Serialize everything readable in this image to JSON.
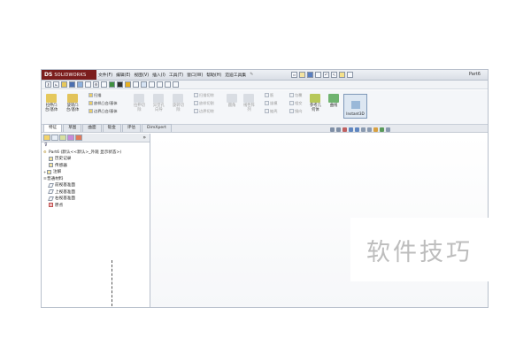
{
  "app": {
    "logo_mark": "DS",
    "logo_name": "SOLIDWORKS",
    "document_title": "Part6"
  },
  "menu": [
    "文件(F)",
    "编辑(E)",
    "视图(V)",
    "插入(I)",
    "工具(T)",
    "窗口(W)",
    "帮助(H)",
    "迈迪工具集"
  ],
  "ribbon": {
    "extrude_boss": "拉伸凸\n台/基体",
    "revolve_boss": "旋转凸\n台/基体",
    "sweep": "扫描",
    "loft": "放样凸台/基体",
    "boundary_boss": "边界凸台/基体",
    "extrude_cut": "拉伸切\n除",
    "hole_wizard": "异型孔\n向导",
    "revolve_cut": "旋转切\n除",
    "swept_cut": "扫描切除",
    "lofted_cut": "放样切割",
    "boundary_cut": "边界切除",
    "fillet": "圆角",
    "linear_pattern": "线性阵\n列",
    "rib": "筋",
    "wrap": "包覆",
    "draft": "拔模",
    "intersect": "相交",
    "shell": "抽壳",
    "mirror": "镜向",
    "reference_geometry": "参考几\n何体",
    "curves": "曲线",
    "instant3d": "Instant3D"
  },
  "tabs": [
    "特征",
    "草图",
    "曲面",
    "钣金",
    "评估",
    "DimXpert"
  ],
  "feature_tree": {
    "filter_icon": "filter-icon",
    "root": "Part6 (默认<<默认>_外观 显示状态>)",
    "items": [
      "历史记录",
      "传感器",
      "注解",
      "普通材料",
      "前视基准面",
      "上视基准面",
      "右视基准面",
      "原点"
    ]
  },
  "panel_collapse": "»",
  "watermark": "软件技巧",
  "colors": {
    "brand": "#7b1d1d",
    "instant_active": "#dde7f2",
    "watermark": "#bdbdbd"
  }
}
